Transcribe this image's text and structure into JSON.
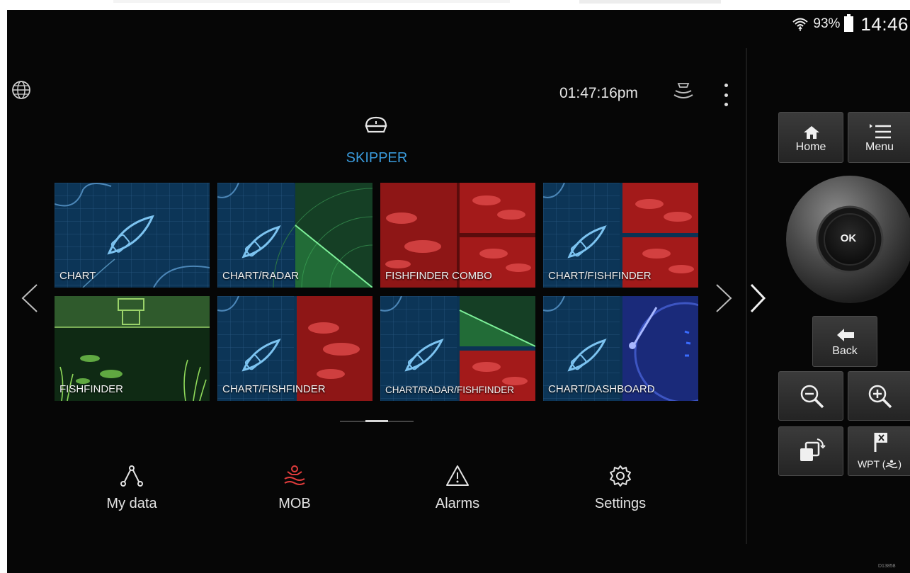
{
  "status_bar": {
    "battery_percent": "93%",
    "clock": "14:46"
  },
  "header": {
    "time": "01:47:16pm",
    "profile_name": "SKIPPER"
  },
  "tiles": [
    {
      "label": "CHART"
    },
    {
      "label": "CHART/RADAR"
    },
    {
      "label": "FISHFINDER COMBO"
    },
    {
      "label": "CHART/FISHFINDER"
    },
    {
      "label": "FISHFINDER"
    },
    {
      "label": "CHART/FISHFINDER"
    },
    {
      "label": "CHART/RADAR/FISHFINDER"
    },
    {
      "label": "CHART/DASHBOARD"
    }
  ],
  "bottom_bar": {
    "my_data": "My data",
    "mob": "MOB",
    "alarms": "Alarms",
    "settings": "Settings"
  },
  "controls": {
    "home": "Home",
    "menu": "Menu",
    "ok": "OK",
    "back": "Back",
    "wpt": "WPT (",
    "wpt_end": ")"
  },
  "footer_code": "D13858",
  "colors": {
    "chart_blue": "#0b3354",
    "radar_green": "#1f5a35",
    "fish_red": "#8a1515",
    "accent_blue": "#3a9bdc",
    "mob_red": "#e03c3c"
  },
  "icons": [
    "wifi-icon",
    "battery-icon",
    "globe-icon",
    "sonar-icon",
    "more-icon",
    "captain-hat-icon",
    "chevron-left-icon",
    "chevron-right-icon",
    "share-nodes-icon",
    "mob-icon",
    "warning-icon",
    "gear-icon",
    "home-icon",
    "menu-icon",
    "back-arrow-icon",
    "zoom-out-icon",
    "zoom-in-icon",
    "switch-window-icon",
    "waypoint-flag-icon"
  ]
}
